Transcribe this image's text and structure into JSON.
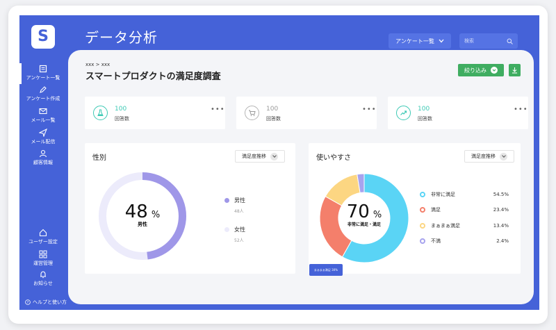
{
  "app": {
    "logo_letter": "S",
    "title": "データ分析"
  },
  "sidebar": {
    "items": [
      {
        "label": "アンケート一覧",
        "icon": "list-icon"
      },
      {
        "label": "アンケート作成",
        "icon": "pen-icon"
      },
      {
        "label": "メール一覧",
        "icon": "mail-icon"
      },
      {
        "label": "メール配信",
        "icon": "send-icon"
      },
      {
        "label": "顧客情報",
        "icon": "person-icon"
      },
      {
        "label": "ユーザー設定",
        "icon": "home-icon"
      },
      {
        "label": "運営管理",
        "icon": "grid-icon"
      },
      {
        "label": "お知らせ",
        "icon": "bell-icon"
      }
    ],
    "help_label": "ヘルプと使い方"
  },
  "header": {
    "survey_dropdown_label": "アンケート一覧",
    "search_placeholder": "検索"
  },
  "main": {
    "breadcrumb": "xxx > xxx",
    "page_title": "スマートプロダクトの満足度調査",
    "filter_label": "絞り込み",
    "stats": [
      {
        "value": "100",
        "label": "回答数",
        "icon": "flask-icon",
        "color": "#3cc9b4"
      },
      {
        "value": "100",
        "label": "回答数",
        "icon": "cart-icon",
        "color": "#9a9a9a"
      },
      {
        "value": "100",
        "label": "回答数",
        "icon": "trend-icon",
        "color": "#3cc9b4"
      }
    ],
    "gender_panel": {
      "title": "性別",
      "select_label": "満足度推移",
      "center_value": "48",
      "center_unit": "%",
      "center_label": "男性",
      "legend": [
        {
          "label": "男性",
          "count": "48人",
          "color": "#9f97e8"
        },
        {
          "label": "女性",
          "count": "52人",
          "color": "#ecebfb"
        }
      ],
      "male_fraction": 0.48
    },
    "usability_panel": {
      "title": "使いやすさ",
      "select_label": "満足度推移",
      "center_value": "70",
      "center_unit": "%",
      "center_label": "非常に満足・満足",
      "legend": [
        {
          "label": "非常に満足",
          "value": "54.5%",
          "color": "#5ad4f5"
        },
        {
          "label": "満足",
          "value": "23.4%",
          "color": "#f47f6b"
        },
        {
          "label": "まぁまぁ満足",
          "value": "13.4%",
          "color": "#fcd682"
        },
        {
          "label": "不満",
          "value": "2.4%",
          "color": "#a7a3ee"
        }
      ],
      "tooltip": "まぁまぁ満足 30%"
    }
  },
  "colors": {
    "brand": "#4562d8",
    "accent_green": "#3fad61"
  }
}
